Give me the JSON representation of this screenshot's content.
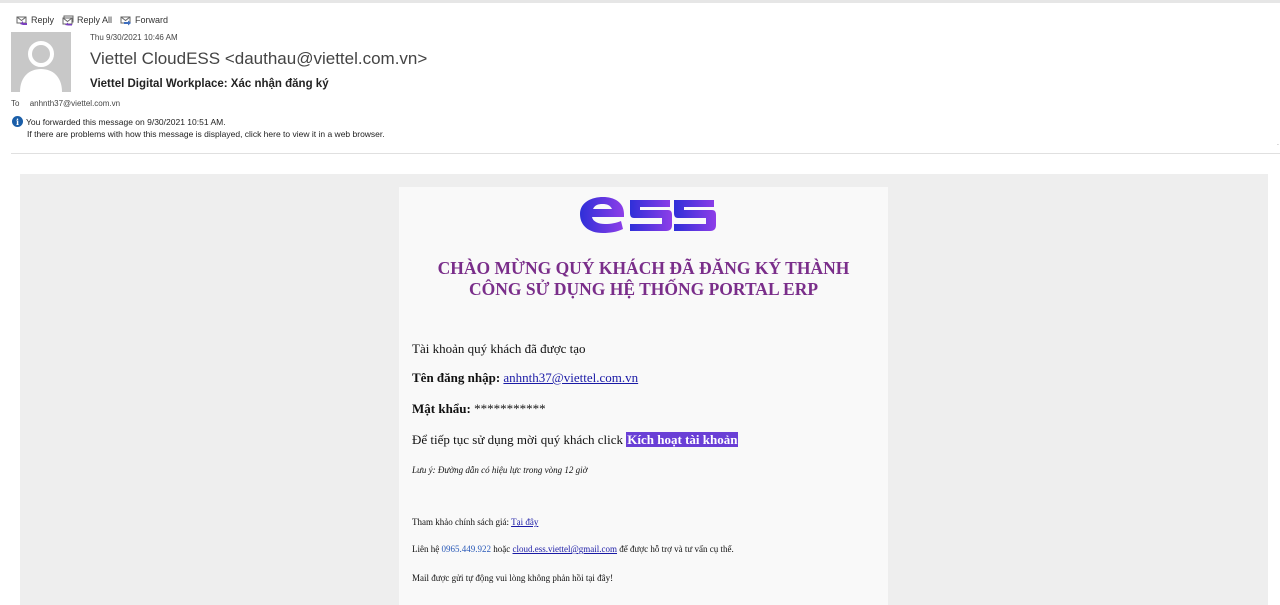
{
  "toolbar": {
    "reply": "Reply",
    "reply_all": "Reply All",
    "forward": "Forward"
  },
  "message": {
    "date": "Thu 9/30/2021 10:46 AM",
    "sender": "Viettel CloudESS <dauthau@viettel.com.vn>",
    "subject": "Viettel Digital Workplace: Xác nhận đăng ký",
    "to_label": "To",
    "to": "anhnth37@viettel.com.vn",
    "forward_note": "You forwarded this message on 9/30/2021 10:51 AM.",
    "display_note": "If there are problems with how this message is displayed, click here to view it in a web browser."
  },
  "email": {
    "logo_text": "ess",
    "welcome_line1": "CHÀO MỪNG QUÝ KHÁCH ĐÃ ĐĂNG KÝ THÀNH",
    "welcome_line2": "CÔNG SỬ DỤNG HỆ THỐNG PORTAL ERP",
    "account_created": "Tài khoản quý khách đã được tạo",
    "username_label": "Tên đăng nhập:",
    "username": "anhnth37@viettel.com.vn",
    "password_label": "Mật khẩu:",
    "password": "***********",
    "continue_text": "Để tiếp tục sử dụng mời quý khách click",
    "activate_label": "Kích hoạt tài khoản",
    "note": "Lưu ý: Đường dẫn có hiệu lực trong vòng 12 giờ",
    "pricing_text": "Tham khảo chính sách giá:",
    "pricing_link": "Tại đây",
    "contact_prefix": "Liên hệ",
    "contact_phone": "0965.449.922",
    "contact_or": "hoặc",
    "contact_email": "cloud.ess.viettel@gmail.com",
    "contact_suffix": "để được hỗ trợ và tư vấn cụ thể.",
    "auto_mail": "Mail được gửi tự động vui lòng không phản hồi tại đây!"
  },
  "colors": {
    "title_purple": "#7a2e8a",
    "activate_bg": "#6a3fd6",
    "logo_gradient_start": "#2f2fd8",
    "logo_gradient_end": "#8e3ee8",
    "link": "#1a1aa6"
  },
  "icons": [
    "reply-icon",
    "reply-all-icon",
    "forward-icon",
    "avatar-person-icon",
    "info-icon"
  ]
}
